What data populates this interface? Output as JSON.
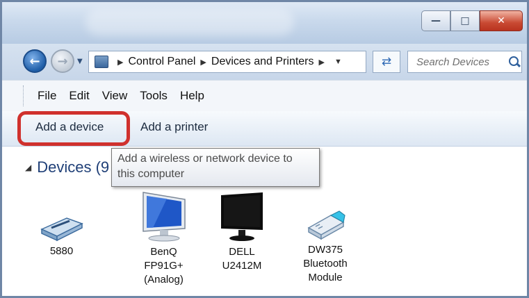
{
  "breadcrumb": [
    "Control Panel",
    "Devices and Printers"
  ],
  "search": {
    "placeholder": "Search Devices"
  },
  "menu": [
    "File",
    "Edit",
    "View",
    "Tools",
    "Help"
  ],
  "commands": {
    "add_device": "Add a device",
    "add_printer": "Add a printer"
  },
  "group": {
    "label": "Devices (9"
  },
  "tooltip": {
    "line1": "Add a wireless or network device to",
    "line2": "this computer"
  },
  "devices": [
    {
      "lines": [
        "5880"
      ],
      "icon": "card-reader-icon"
    },
    {
      "lines": [
        "BenQ",
        "FP91G+",
        "(Analog)"
      ],
      "icon": "monitor-icon"
    },
    {
      "lines": [
        "DELL",
        "U2412M"
      ],
      "icon": "monitor-icon"
    },
    {
      "lines": [
        "DW375",
        "Bluetooth",
        "Module"
      ],
      "icon": "usb-bluetooth-icon"
    }
  ],
  "colors": {
    "highlight": "#d0312d",
    "close_button": "#c94a33",
    "group_label": "#1f3f77"
  }
}
